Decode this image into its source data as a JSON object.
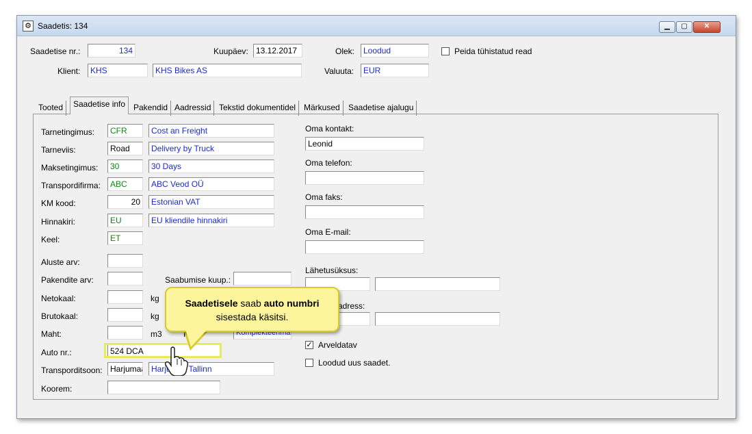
{
  "window": {
    "title": "Saadetis: 134",
    "icon": "form-icon"
  },
  "header": {
    "saadetise_nr_label": "Saadetise nr.:",
    "saadetise_nr": "134",
    "kuupaev_label": "Kuupäev:",
    "kuupaev": "13.12.2017",
    "olek_label": "Olek:",
    "olek": "Loodud",
    "peida_label": "Peida tühistatud read",
    "klient_label": "Klient:",
    "klient_code": "KHS",
    "klient_name": "KHS Bikes AS",
    "valuuta_label": "Valuuta:",
    "valuuta": "EUR"
  },
  "tabs": [
    "Tooted",
    "Saadetise info",
    "Pakendid",
    "Aadressid",
    "Tekstid dokumentidel",
    "Märkused",
    "Saadetise ajalugu"
  ],
  "left": {
    "tarnetingimus_label": "Tarnetingimus:",
    "tarnetingimus_code": "CFR",
    "tarnetingimus_name": "Cost an Freight",
    "tarneviis_label": "Tarneviis:",
    "tarneviis_code": "Road",
    "tarneviis_name": "Delivery by Truck",
    "maksetingimus_label": "Maksetingimus:",
    "maksetingimus_code": "30",
    "maksetingimus_name": "30 Days",
    "transpordifirma_label": "Transpordifirma:",
    "transpordifirma_code": "ABC",
    "transpordifirma_name": "ABC Veod OÜ",
    "km_label": "KM kood:",
    "km_code": "20",
    "km_name": "Estonian VAT",
    "hinnakiri_label": "Hinnakiri:",
    "hinnakiri_code": "EU",
    "hinnakiri_name": "EU kliendile hinnakiri",
    "keel_label": "Keel:",
    "keel_code": "ET",
    "aluste_label": "Aluste arv:",
    "pakendite_label": "Pakendite arv:",
    "saabumise_label": "Saabumise kuup.:",
    "netokaal_label": "Netokaal:",
    "netokaal_unit": "kg",
    "brutokaal_label": "Brutokaal:",
    "brutokaal_unit": "kg",
    "maht_label": "Maht:",
    "maht_unit": "m3",
    "koostaja_label": "Ko",
    "koostaja_value": "Komplekteerima",
    "auto_label": "Auto nr.:",
    "auto_value": "524 DCA",
    "transporditsoon_label": "Transporditsoon:",
    "transporditsoon_code": "Harjumaa",
    "transporditsoon_name": "Harju    ja Tallinn",
    "koorem_label": "Koorem:"
  },
  "right": {
    "oma_kontakt_label": "Oma kontakt:",
    "oma_kontakt": "Leonid",
    "oma_telefon_label": "Oma telefon:",
    "oma_faks_label": "Oma faks:",
    "oma_email_label": "Oma E-mail:",
    "lahetusuksus_label": "Lähetusüksus:",
    "adress_label": "adress:",
    "arveldatav_label": "Arveldatav",
    "loodud_uus_label": "Loodud uus saadet."
  },
  "callout": {
    "bold1": "Saadetisele",
    "text1": " saab ",
    "bold2": "auto numbri",
    "text2": "sisestada käsitsi."
  }
}
